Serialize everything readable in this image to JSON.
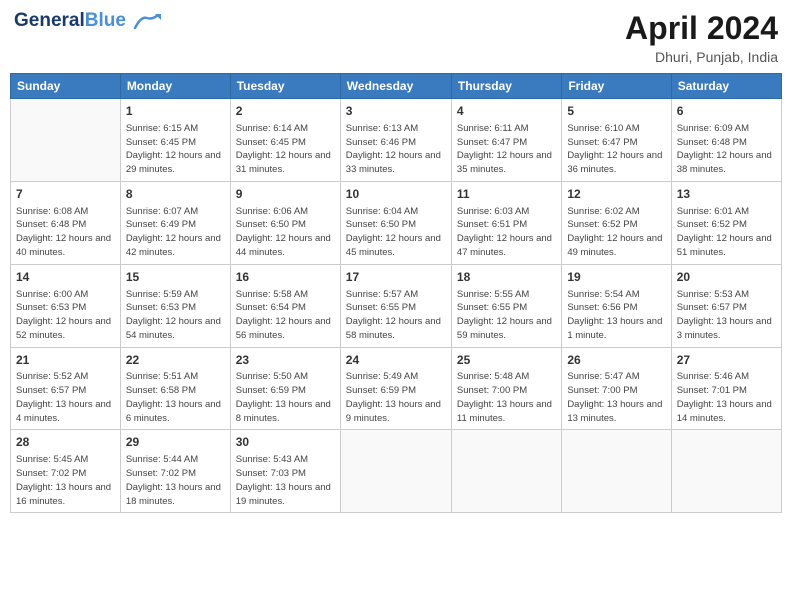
{
  "header": {
    "logo_general": "General",
    "logo_blue": "Blue",
    "month": "April 2024",
    "location": "Dhuri, Punjab, India"
  },
  "columns": [
    "Sunday",
    "Monday",
    "Tuesday",
    "Wednesday",
    "Thursday",
    "Friday",
    "Saturday"
  ],
  "weeks": [
    [
      {
        "day": "",
        "sunrise": "",
        "sunset": "",
        "daylight": ""
      },
      {
        "day": "1",
        "sunrise": "Sunrise: 6:15 AM",
        "sunset": "Sunset: 6:45 PM",
        "daylight": "Daylight: 12 hours and 29 minutes."
      },
      {
        "day": "2",
        "sunrise": "Sunrise: 6:14 AM",
        "sunset": "Sunset: 6:45 PM",
        "daylight": "Daylight: 12 hours and 31 minutes."
      },
      {
        "day": "3",
        "sunrise": "Sunrise: 6:13 AM",
        "sunset": "Sunset: 6:46 PM",
        "daylight": "Daylight: 12 hours and 33 minutes."
      },
      {
        "day": "4",
        "sunrise": "Sunrise: 6:11 AM",
        "sunset": "Sunset: 6:47 PM",
        "daylight": "Daylight: 12 hours and 35 minutes."
      },
      {
        "day": "5",
        "sunrise": "Sunrise: 6:10 AM",
        "sunset": "Sunset: 6:47 PM",
        "daylight": "Daylight: 12 hours and 36 minutes."
      },
      {
        "day": "6",
        "sunrise": "Sunrise: 6:09 AM",
        "sunset": "Sunset: 6:48 PM",
        "daylight": "Daylight: 12 hours and 38 minutes."
      }
    ],
    [
      {
        "day": "7",
        "sunrise": "Sunrise: 6:08 AM",
        "sunset": "Sunset: 6:48 PM",
        "daylight": "Daylight: 12 hours and 40 minutes."
      },
      {
        "day": "8",
        "sunrise": "Sunrise: 6:07 AM",
        "sunset": "Sunset: 6:49 PM",
        "daylight": "Daylight: 12 hours and 42 minutes."
      },
      {
        "day": "9",
        "sunrise": "Sunrise: 6:06 AM",
        "sunset": "Sunset: 6:50 PM",
        "daylight": "Daylight: 12 hours and 44 minutes."
      },
      {
        "day": "10",
        "sunrise": "Sunrise: 6:04 AM",
        "sunset": "Sunset: 6:50 PM",
        "daylight": "Daylight: 12 hours and 45 minutes."
      },
      {
        "day": "11",
        "sunrise": "Sunrise: 6:03 AM",
        "sunset": "Sunset: 6:51 PM",
        "daylight": "Daylight: 12 hours and 47 minutes."
      },
      {
        "day": "12",
        "sunrise": "Sunrise: 6:02 AM",
        "sunset": "Sunset: 6:52 PM",
        "daylight": "Daylight: 12 hours and 49 minutes."
      },
      {
        "day": "13",
        "sunrise": "Sunrise: 6:01 AM",
        "sunset": "Sunset: 6:52 PM",
        "daylight": "Daylight: 12 hours and 51 minutes."
      }
    ],
    [
      {
        "day": "14",
        "sunrise": "Sunrise: 6:00 AM",
        "sunset": "Sunset: 6:53 PM",
        "daylight": "Daylight: 12 hours and 52 minutes."
      },
      {
        "day": "15",
        "sunrise": "Sunrise: 5:59 AM",
        "sunset": "Sunset: 6:53 PM",
        "daylight": "Daylight: 12 hours and 54 minutes."
      },
      {
        "day": "16",
        "sunrise": "Sunrise: 5:58 AM",
        "sunset": "Sunset: 6:54 PM",
        "daylight": "Daylight: 12 hours and 56 minutes."
      },
      {
        "day": "17",
        "sunrise": "Sunrise: 5:57 AM",
        "sunset": "Sunset: 6:55 PM",
        "daylight": "Daylight: 12 hours and 58 minutes."
      },
      {
        "day": "18",
        "sunrise": "Sunrise: 5:55 AM",
        "sunset": "Sunset: 6:55 PM",
        "daylight": "Daylight: 12 hours and 59 minutes."
      },
      {
        "day": "19",
        "sunrise": "Sunrise: 5:54 AM",
        "sunset": "Sunset: 6:56 PM",
        "daylight": "Daylight: 13 hours and 1 minute."
      },
      {
        "day": "20",
        "sunrise": "Sunrise: 5:53 AM",
        "sunset": "Sunset: 6:57 PM",
        "daylight": "Daylight: 13 hours and 3 minutes."
      }
    ],
    [
      {
        "day": "21",
        "sunrise": "Sunrise: 5:52 AM",
        "sunset": "Sunset: 6:57 PM",
        "daylight": "Daylight: 13 hours and 4 minutes."
      },
      {
        "day": "22",
        "sunrise": "Sunrise: 5:51 AM",
        "sunset": "Sunset: 6:58 PM",
        "daylight": "Daylight: 13 hours and 6 minutes."
      },
      {
        "day": "23",
        "sunrise": "Sunrise: 5:50 AM",
        "sunset": "Sunset: 6:59 PM",
        "daylight": "Daylight: 13 hours and 8 minutes."
      },
      {
        "day": "24",
        "sunrise": "Sunrise: 5:49 AM",
        "sunset": "Sunset: 6:59 PM",
        "daylight": "Daylight: 13 hours and 9 minutes."
      },
      {
        "day": "25",
        "sunrise": "Sunrise: 5:48 AM",
        "sunset": "Sunset: 7:00 PM",
        "daylight": "Daylight: 13 hours and 11 minutes."
      },
      {
        "day": "26",
        "sunrise": "Sunrise: 5:47 AM",
        "sunset": "Sunset: 7:00 PM",
        "daylight": "Daylight: 13 hours and 13 minutes."
      },
      {
        "day": "27",
        "sunrise": "Sunrise: 5:46 AM",
        "sunset": "Sunset: 7:01 PM",
        "daylight": "Daylight: 13 hours and 14 minutes."
      }
    ],
    [
      {
        "day": "28",
        "sunrise": "Sunrise: 5:45 AM",
        "sunset": "Sunset: 7:02 PM",
        "daylight": "Daylight: 13 hours and 16 minutes."
      },
      {
        "day": "29",
        "sunrise": "Sunrise: 5:44 AM",
        "sunset": "Sunset: 7:02 PM",
        "daylight": "Daylight: 13 hours and 18 minutes."
      },
      {
        "day": "30",
        "sunrise": "Sunrise: 5:43 AM",
        "sunset": "Sunset: 7:03 PM",
        "daylight": "Daylight: 13 hours and 19 minutes."
      },
      {
        "day": "",
        "sunrise": "",
        "sunset": "",
        "daylight": ""
      },
      {
        "day": "",
        "sunrise": "",
        "sunset": "",
        "daylight": ""
      },
      {
        "day": "",
        "sunrise": "",
        "sunset": "",
        "daylight": ""
      },
      {
        "day": "",
        "sunrise": "",
        "sunset": "",
        "daylight": ""
      }
    ]
  ]
}
